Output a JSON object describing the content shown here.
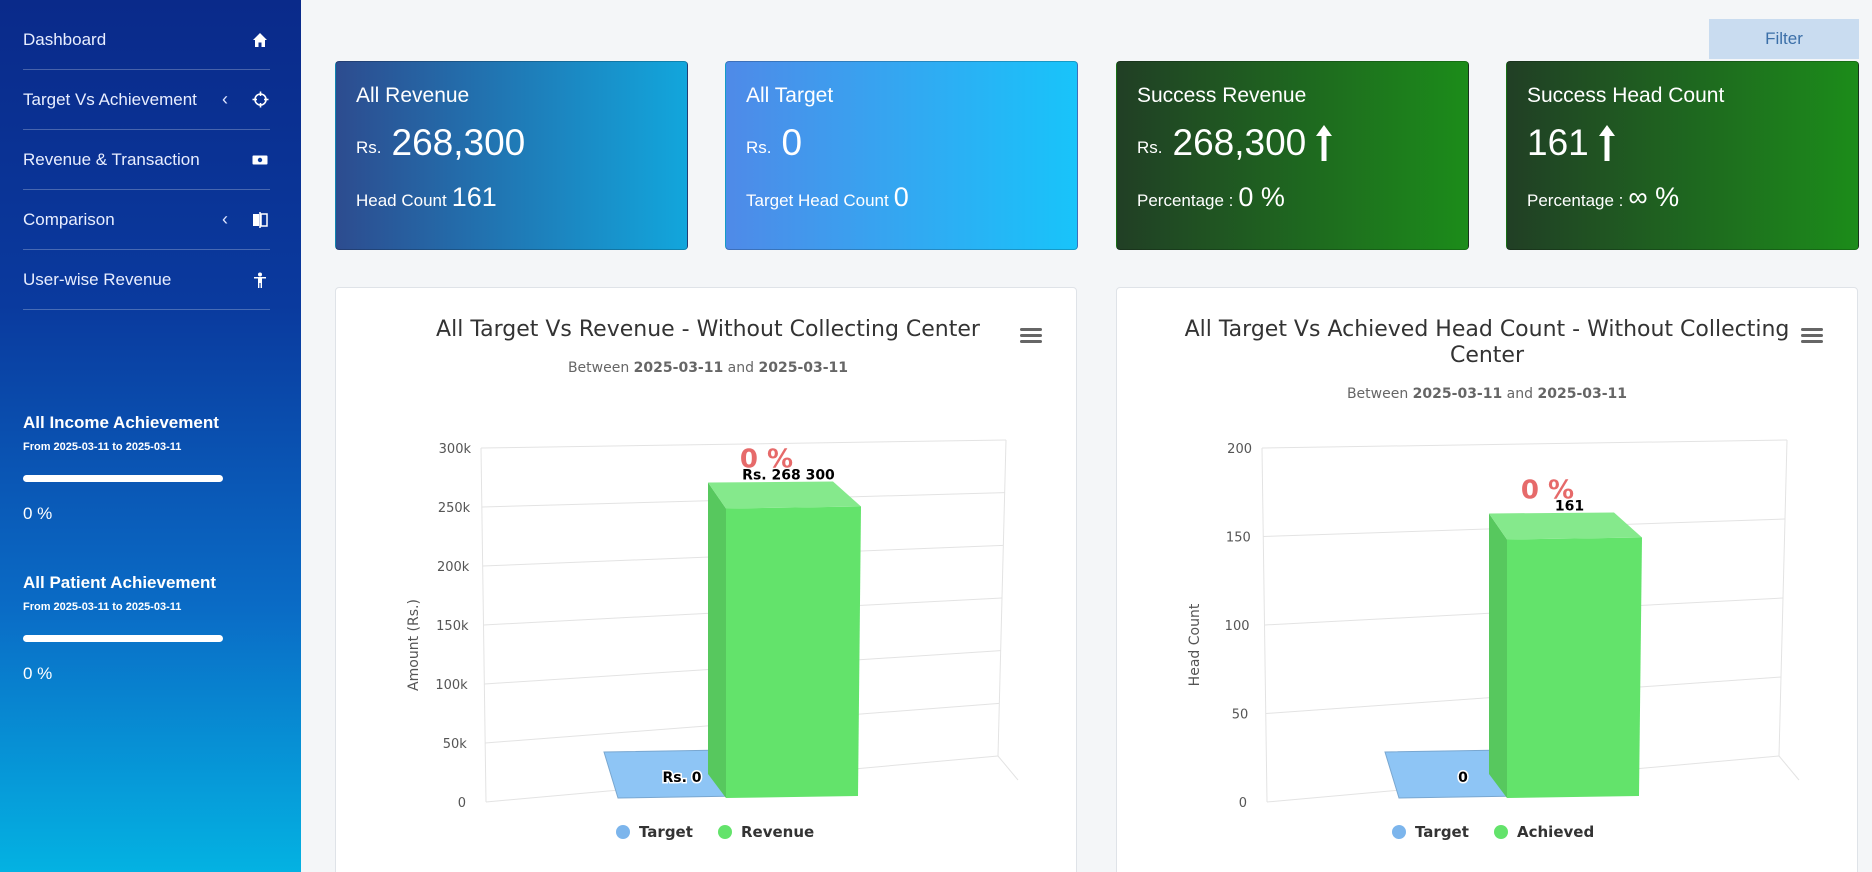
{
  "sidebar": {
    "items": [
      {
        "label": "Dashboard",
        "icon": "home-icon",
        "has_chevron": false
      },
      {
        "label": "Target Vs Achievement",
        "icon": "crosshair-icon",
        "has_chevron": true
      },
      {
        "label": "Revenue & Transaction",
        "icon": "money-icon",
        "has_chevron": false
      },
      {
        "label": "Comparison",
        "icon": "compare-icon",
        "has_chevron": true
      },
      {
        "label": "User-wise Revenue",
        "icon": "person-icon",
        "has_chevron": false
      }
    ],
    "income": {
      "title": "All Income Achievement",
      "range": "From 2025-03-11 to 2025-03-11",
      "value": "0 %",
      "progress": 0
    },
    "patient": {
      "title": "All Patient Achievement",
      "range": "From 2025-03-11 to 2025-03-11",
      "value": "0 %",
      "progress": 0
    }
  },
  "filter_label": "Filter",
  "cards": [
    {
      "title": "All Revenue",
      "currency": "Rs.",
      "value": "268,300",
      "foot_label": "Head Count",
      "foot_value": "161",
      "arrow": false,
      "colors": [
        "#2d4c8f",
        "#12a6dc"
      ]
    },
    {
      "title": "All Target",
      "currency": "Rs.",
      "value": "0",
      "foot_label": "Target Head Count",
      "foot_value": "0",
      "arrow": false,
      "colors": [
        "#4f8ae8",
        "#18c4fa"
      ]
    },
    {
      "title": "Success Revenue",
      "currency": "Rs.",
      "value": "268,300",
      "foot_label": "Percentage :",
      "foot_value": "0 %",
      "arrow": true,
      "colors": [
        "#213f25",
        "#1c8c1a"
      ]
    },
    {
      "title": "Success Head Count",
      "currency": "",
      "value": "161",
      "foot_label": "Percentage :",
      "foot_value": "∞ %",
      "arrow": true,
      "colors": [
        "#213f25",
        "#1c8c1a"
      ]
    }
  ],
  "chart_data": [
    {
      "type": "bar",
      "title": "All Target Vs Revenue - Without Collecting Center",
      "subtitle_prefix": "Between",
      "subtitle_from": "2025-03-11",
      "subtitle_and": "and",
      "subtitle_to": "2025-03-11",
      "ylabel": "Amount (Rs.)",
      "ylim": [
        0,
        300000
      ],
      "yticks": [
        "0",
        "50k",
        "100k",
        "150k",
        "200k",
        "250k",
        "300k"
      ],
      "series": [
        {
          "name": "Target",
          "value": 0,
          "label": "Rs. 0",
          "color": "#8ec5f5"
        },
        {
          "name": "Revenue",
          "value": 268300,
          "label": "Rs. 268 300",
          "color": "#63e36b"
        }
      ],
      "percent_label": "0 %",
      "grid": true,
      "legend": "bottom"
    },
    {
      "type": "bar",
      "title": "All Target Vs Achieved Head Count - Without Collecting Center",
      "subtitle_prefix": "Between",
      "subtitle_from": "2025-03-11",
      "subtitle_and": "and",
      "subtitle_to": "2025-03-11",
      "ylabel": "Head Count",
      "ylim": [
        0,
        200
      ],
      "yticks": [
        "0",
        "50",
        "100",
        "150",
        "200"
      ],
      "series": [
        {
          "name": "Target",
          "value": 0,
          "label": "0",
          "color": "#8ec5f5"
        },
        {
          "name": "Achieved",
          "value": 161,
          "label": "161",
          "color": "#63e36b"
        }
      ],
      "percent_label": "0 %",
      "grid": true,
      "legend": "bottom"
    }
  ]
}
